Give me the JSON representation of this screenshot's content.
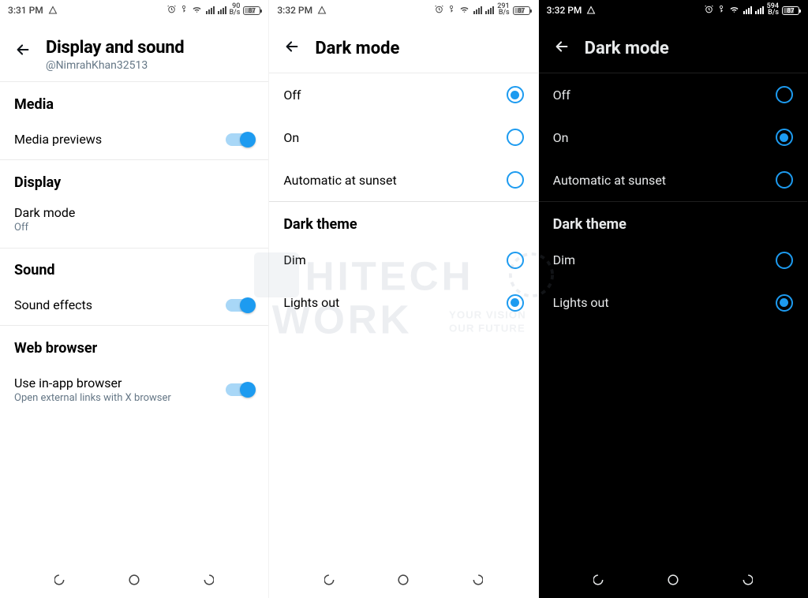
{
  "phone1": {
    "status": {
      "time": "3:31 PM",
      "speed_num": "90",
      "speed_unit": "B/s",
      "battery": "87"
    },
    "header": {
      "title": "Display and sound",
      "subtitle": "@NimrahKhan32513"
    },
    "sections": {
      "media": {
        "label": "Media",
        "previews": "Media previews"
      },
      "display": {
        "label": "Display",
        "dark_mode_title": "Dark mode",
        "dark_mode_value": "Off"
      },
      "sound": {
        "label": "Sound",
        "effects": "Sound effects"
      },
      "web": {
        "label": "Web browser",
        "inapp_title": "Use in-app browser",
        "inapp_sub": "Open external links with X browser"
      }
    }
  },
  "phone2": {
    "status": {
      "time": "3:32 PM",
      "speed_num": "291",
      "speed_unit": "B/s",
      "battery": "87"
    },
    "header": {
      "title": "Dark mode"
    },
    "modes": {
      "off": "Off",
      "on": "On",
      "auto": "Automatic at sunset"
    },
    "theme": {
      "label": "Dark theme",
      "dim": "Dim",
      "lights_out": "Lights out"
    }
  },
  "phone3": {
    "status": {
      "time": "3:32 PM",
      "speed_num": "594",
      "speed_unit": "B/s",
      "battery": "87"
    },
    "header": {
      "title": "Dark mode"
    },
    "modes": {
      "off": "Off",
      "on": "On",
      "auto": "Automatic at sunset"
    },
    "theme": {
      "label": "Dark theme",
      "dim": "Dim",
      "lights_out": "Lights out"
    }
  },
  "watermark": {
    "line1": "HITECH",
    "line2": "WORK",
    "tag1": "YOUR VISION",
    "tag2": "OUR FUTURE"
  }
}
